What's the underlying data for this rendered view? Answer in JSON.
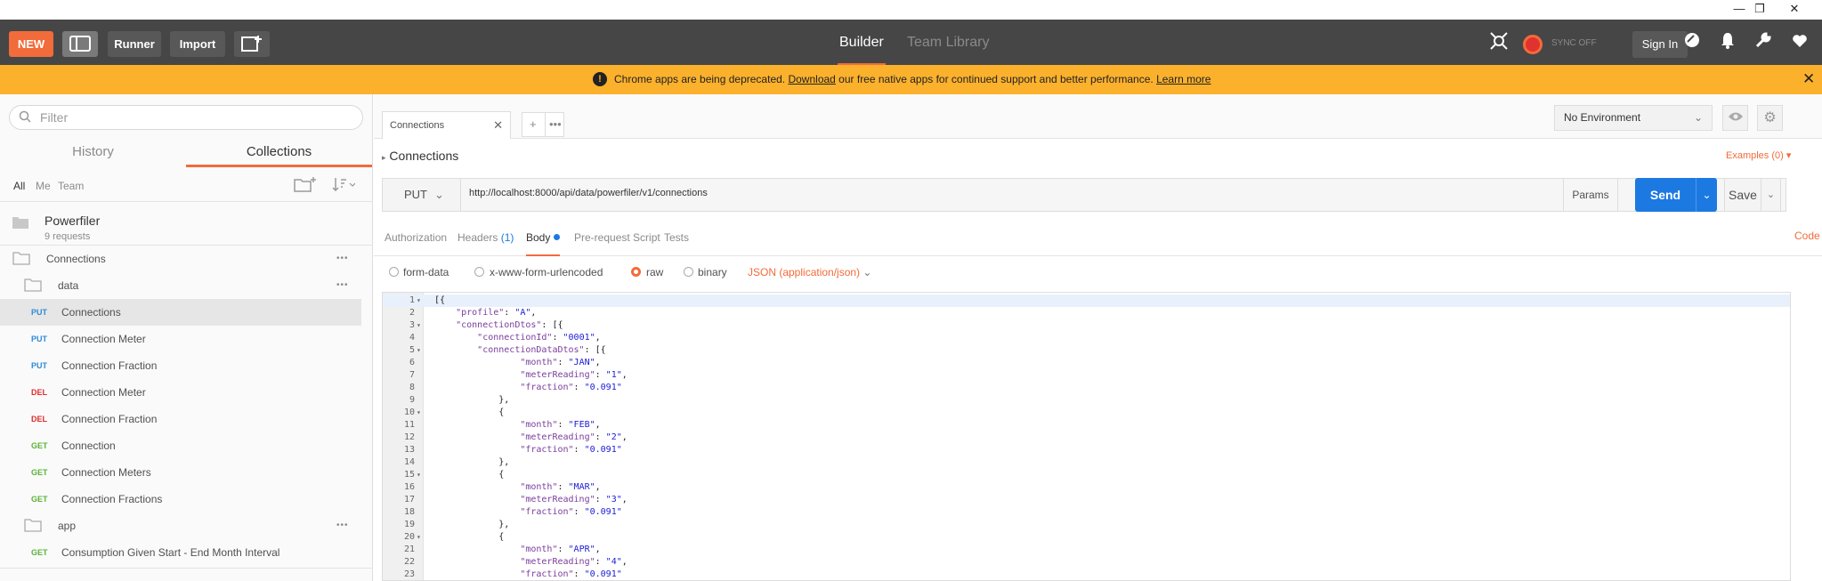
{
  "window": {
    "minimize_icon": "—",
    "restore_icon": "❐",
    "close_icon": "✕"
  },
  "header": {
    "new_label": "NEW",
    "runner_label": "Runner",
    "import_label": "Import",
    "builder_label": "Builder",
    "team_library_label": "Team Library",
    "sync_label": "SYNC OFF",
    "signin_label": "Sign In"
  },
  "banner": {
    "text_before": "Chrome apps are being deprecated. ",
    "download_link": "Download",
    "text_middle": " our free native apps for continued support and better performance. ",
    "learn_more_link": "Learn more"
  },
  "sidebar": {
    "filter_placeholder": "Filter",
    "tabs": {
      "history": "History",
      "collections": "Collections"
    },
    "filters": {
      "all": "All",
      "me": "Me",
      "team": "Team"
    },
    "collection": {
      "name": "Powerfiler",
      "subtitle": "9 requests"
    },
    "tree": [
      {
        "type": "folder",
        "label": "Connections",
        "indent": 0
      },
      {
        "type": "folder",
        "label": "data",
        "indent": 1
      },
      {
        "type": "request",
        "method": "PUT",
        "label": "Connections",
        "active": true
      },
      {
        "type": "request",
        "method": "PUT",
        "label": "Connection Meter"
      },
      {
        "type": "request",
        "method": "PUT",
        "label": "Connection Fraction"
      },
      {
        "type": "request",
        "method": "DEL",
        "label": "Connection Meter"
      },
      {
        "type": "request",
        "method": "DEL",
        "label": "Connection Fraction"
      },
      {
        "type": "request",
        "method": "GET",
        "label": "Connection"
      },
      {
        "type": "request",
        "method": "GET",
        "label": "Connection Meters"
      },
      {
        "type": "request",
        "method": "GET",
        "label": "Connection Fractions"
      },
      {
        "type": "folder",
        "label": "app",
        "indent": 1
      },
      {
        "type": "request",
        "method": "GET",
        "label": "Consumption Given Start - End Month Interval"
      }
    ]
  },
  "main": {
    "tab_label": "Connections",
    "environment": "No Environment",
    "request_title": "Connections",
    "examples_label": "Examples (0)",
    "method": "PUT",
    "url": "http://localhost:8000/api/data/powerfiler/v1/connections",
    "params_label": "Params",
    "send_label": "Send",
    "save_label": "Save",
    "request_tabs": {
      "authorization": "Authorization",
      "headers": "Headers",
      "headers_count": "(1)",
      "body": "Body",
      "prerequest": "Pre-request Script",
      "tests": "Tests"
    },
    "code_label": "Code",
    "body_options": {
      "form_data": "form-data",
      "urlencoded": "x-www-form-urlencoded",
      "raw": "raw",
      "binary": "binary",
      "content_type": "JSON (application/json)"
    },
    "code_lines": [
      {
        "n": "1",
        "fold": true,
        "text": "[{"
      },
      {
        "n": "2",
        "fold": false,
        "text": "    \"profile\": \"A\","
      },
      {
        "n": "3",
        "fold": true,
        "text": "    \"connectionDtos\": [{"
      },
      {
        "n": "4",
        "fold": false,
        "text": "        \"connectionId\": \"0001\","
      },
      {
        "n": "5",
        "fold": true,
        "text": "        \"connectionDataDtos\": [{"
      },
      {
        "n": "6",
        "fold": false,
        "text": "                \"month\": \"JAN\","
      },
      {
        "n": "7",
        "fold": false,
        "text": "                \"meterReading\": \"1\","
      },
      {
        "n": "8",
        "fold": false,
        "text": "                \"fraction\": \"0.091\""
      },
      {
        "n": "9",
        "fold": false,
        "text": "            },"
      },
      {
        "n": "10",
        "fold": true,
        "text": "            {"
      },
      {
        "n": "11",
        "fold": false,
        "text": "                \"month\": \"FEB\","
      },
      {
        "n": "12",
        "fold": false,
        "text": "                \"meterReading\": \"2\","
      },
      {
        "n": "13",
        "fold": false,
        "text": "                \"fraction\": \"0.091\""
      },
      {
        "n": "14",
        "fold": false,
        "text": "            },"
      },
      {
        "n": "15",
        "fold": true,
        "text": "            {"
      },
      {
        "n": "16",
        "fold": false,
        "text": "                \"month\": \"MAR\","
      },
      {
        "n": "17",
        "fold": false,
        "text": "                \"meterReading\": \"3\","
      },
      {
        "n": "18",
        "fold": false,
        "text": "                \"fraction\": \"0.091\""
      },
      {
        "n": "19",
        "fold": false,
        "text": "            },"
      },
      {
        "n": "20",
        "fold": true,
        "text": "            {"
      },
      {
        "n": "21",
        "fold": false,
        "text": "                \"month\": \"APR\","
      },
      {
        "n": "22",
        "fold": false,
        "text": "                \"meterReading\": \"4\","
      },
      {
        "n": "23",
        "fold": false,
        "text": "                \"fraction\": \"0.091\""
      }
    ]
  },
  "colors": {
    "accent": "#f26b3a",
    "header_bg": "#464646",
    "banner_bg": "#fbb12c",
    "send_blue": "#1c79e2",
    "put": "#2d8bd8",
    "del": "#e02d2d",
    "get": "#5bb339"
  }
}
